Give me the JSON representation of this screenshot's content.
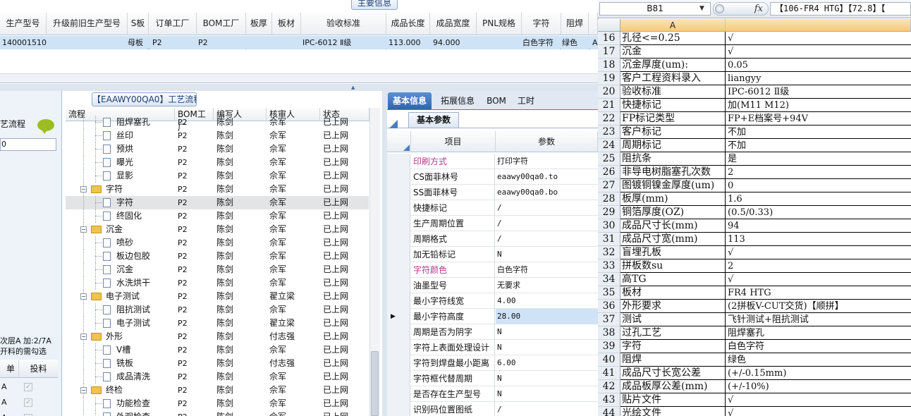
{
  "main_info": {
    "title": "主要信息",
    "columns": [
      "生产型号",
      "升级前旧生产型号",
      "S板",
      "订单工厂",
      "BOM工厂",
      "板厚",
      "板材",
      "验收标准",
      "成品长度",
      "成品宽度",
      "PNL规格",
      "字符",
      "阻焊",
      ""
    ],
    "row": [
      "1400015109",
      "",
      "母板",
      "P2",
      "P2",
      "",
      "",
      "IPC-6012 Ⅱ级",
      "113.000",
      "94.000",
      "",
      "白色字符",
      "绿色",
      "A"
    ]
  },
  "left_panel": {
    "title": "艺流程",
    "field_value": "0",
    "note_line1": "次层A 加:2/7A",
    "note_line2": "开料的需勾选",
    "col_order": "单",
    "col_feed": "投料",
    "rows": [
      "A",
      "A",
      "A"
    ]
  },
  "tree": {
    "title": "【EAAWY00QA0】工艺流程",
    "columns": [
      "流程",
      "BOM工厂",
      "编写人",
      "核审人",
      "状态"
    ],
    "rows": [
      {
        "name": "阻焊塞孔",
        "level": 2,
        "type": "doc",
        "bom": "P2",
        "writer": "陈剑",
        "reviewer": "佘军",
        "status": "已上网"
      },
      {
        "name": "丝印",
        "level": 2,
        "type": "doc",
        "bom": "P2",
        "writer": "陈剑",
        "reviewer": "佘军",
        "status": "已上网"
      },
      {
        "name": "预烘",
        "level": 2,
        "type": "doc",
        "bom": "P2",
        "writer": "陈剑",
        "reviewer": "佘军",
        "status": "已上网"
      },
      {
        "name": "曝光",
        "level": 2,
        "type": "doc",
        "bom": "P2",
        "writer": "陈剑",
        "reviewer": "佘军",
        "status": "已上网"
      },
      {
        "name": "显影",
        "level": 2,
        "type": "doc",
        "bom": "P2",
        "writer": "陈剑",
        "reviewer": "佘军",
        "status": "已上网"
      },
      {
        "name": "字符",
        "level": 1,
        "type": "folder",
        "bom": "P2",
        "writer": "陈剑",
        "reviewer": "佘军",
        "status": "已上网"
      },
      {
        "name": "字符",
        "level": 2,
        "type": "doc",
        "bom": "P2",
        "writer": "陈剑",
        "reviewer": "佘军",
        "status": "已上网"
      },
      {
        "name": "终固化",
        "level": 2,
        "type": "doc",
        "bom": "P2",
        "writer": "陈剑",
        "reviewer": "佘军",
        "status": "已上网"
      },
      {
        "name": "沉金",
        "level": 1,
        "type": "folder",
        "bom": "P2",
        "writer": "陈剑",
        "reviewer": "佘军",
        "status": "已上网"
      },
      {
        "name": "喷砂",
        "level": 2,
        "type": "doc",
        "bom": "P2",
        "writer": "陈剑",
        "reviewer": "佘军",
        "status": "已上网"
      },
      {
        "name": "板边包胶",
        "level": 2,
        "type": "doc",
        "bom": "P2",
        "writer": "陈剑",
        "reviewer": "佘军",
        "status": "已上网"
      },
      {
        "name": "沉金",
        "level": 2,
        "type": "doc",
        "bom": "P2",
        "writer": "陈剑",
        "reviewer": "佘军",
        "status": "已上网"
      },
      {
        "name": "水洗烘干",
        "level": 2,
        "type": "doc",
        "bom": "P2",
        "writer": "陈剑",
        "reviewer": "佘军",
        "status": "已上网"
      },
      {
        "name": "电子测试",
        "level": 1,
        "type": "folder",
        "bom": "P2",
        "writer": "陈剑",
        "reviewer": "翟立梁",
        "status": "已上网"
      },
      {
        "name": "阻抗测试",
        "level": 2,
        "type": "doc",
        "bom": "P2",
        "writer": "陈剑",
        "reviewer": "佘军",
        "status": "已上网"
      },
      {
        "name": "电子测试",
        "level": 2,
        "type": "doc",
        "bom": "P2",
        "writer": "陈剑",
        "reviewer": "翟立梁",
        "status": "已上网"
      },
      {
        "name": "外形",
        "level": 1,
        "type": "folder",
        "bom": "P2",
        "writer": "陈剑",
        "reviewer": "付志强",
        "status": "已上网"
      },
      {
        "name": "V槽",
        "level": 2,
        "type": "doc",
        "bom": "P2",
        "writer": "陈剑",
        "reviewer": "佘军",
        "status": "已上网"
      },
      {
        "name": "铣板",
        "level": 2,
        "type": "doc",
        "bom": "P2",
        "writer": "陈剑",
        "reviewer": "付志强",
        "status": "已上网"
      },
      {
        "name": "成品清洗",
        "level": 2,
        "type": "doc",
        "bom": "P2",
        "writer": "陈剑",
        "reviewer": "佘军",
        "status": "已上网"
      },
      {
        "name": "终检",
        "level": 1,
        "type": "folder",
        "bom": "P2",
        "writer": "陈剑",
        "reviewer": "佘军",
        "status": "已上网"
      },
      {
        "name": "功能检查",
        "level": 2,
        "type": "doc",
        "bom": "P2",
        "writer": "陈剑",
        "reviewer": "佘军",
        "status": "已上网"
      },
      {
        "name": "外观检查",
        "level": 2,
        "type": "doc",
        "bom": "P2",
        "writer": "陈剑",
        "reviewer": "佘军",
        "status": "已上网"
      }
    ]
  },
  "info_panel": {
    "tabs": [
      "基本信息",
      "拓展信息",
      "BOM",
      "工时"
    ],
    "sub_tab": "基本参数",
    "col_item": "项目",
    "col_param": "参数",
    "rows": [
      {
        "item": "印刷方式",
        "value": "打印字符",
        "pink": true
      },
      {
        "item": "CS面菲林号",
        "value": "eaawy00qa0.to",
        "pink": false
      },
      {
        "item": "SS面菲林号",
        "value": "eaawy00qa0.bo",
        "pink": false
      },
      {
        "item": "快捷标记",
        "value": "/",
        "pink": false
      },
      {
        "item": "生产周期位置",
        "value": "/",
        "pink": false
      },
      {
        "item": "周期格式",
        "value": "/",
        "pink": false
      },
      {
        "item": "加无铅标记",
        "value": "N",
        "pink": false
      },
      {
        "item": "字符颜色",
        "value": "白色字符",
        "pink": true
      },
      {
        "item": "油墨型号",
        "value": "无要求",
        "pink": false
      },
      {
        "item": "最小字符线宽",
        "value": "4.00",
        "pink": false
      },
      {
        "item": "最小字符高度",
        "value": "28.00",
        "pink": false
      },
      {
        "item": "周期是否为阴字",
        "value": "N",
        "pink": false
      },
      {
        "item": "字符上表面处理设计",
        "value": "N",
        "pink": false
      },
      {
        "item": "字符到焊盘最小距离",
        "value": "6.00",
        "pink": false
      },
      {
        "item": "字符框代替周期",
        "value": "N",
        "pink": false
      },
      {
        "item": "是否存在生产型号",
        "value": "N",
        "pink": false
      },
      {
        "item": "识别码位置图纸",
        "value": "/",
        "pink": false
      }
    ],
    "selected_index": 10
  },
  "excel": {
    "name_box": "B81",
    "fx_label": "fx",
    "formula": "【106-FR4 HTG】【72.8】【",
    "col_a": "A",
    "rows": [
      {
        "n": "16",
        "a": "孔径<=0.25",
        "b": "√"
      },
      {
        "n": "17",
        "a": "沉金",
        "b": "√"
      },
      {
        "n": "18",
        "a": "沉金厚度(um):",
        "b": "0.05"
      },
      {
        "n": "19",
        "a": "客户工程资料录入",
        "b": "liangyy"
      },
      {
        "n": "20",
        "a": "验收标准",
        "b": "IPC-6012 Ⅱ级"
      },
      {
        "n": "21",
        "a": "快捷标记",
        "b": "加(M11 M12)"
      },
      {
        "n": "22",
        "a": "FP标记类型",
        "b": "FP+E档案号+94V"
      },
      {
        "n": "23",
        "a": "客户标记",
        "b": "不加"
      },
      {
        "n": "24",
        "a": "周期标记",
        "b": "不加"
      },
      {
        "n": "25",
        "a": "阻抗条",
        "b": "是"
      },
      {
        "n": "26",
        "a": "非导电树脂塞孔次数",
        "b": "2"
      },
      {
        "n": "27",
        "a": "图镀铜镍金厚度(um)",
        "b": "0"
      },
      {
        "n": "28",
        "a": "板厚(mm)",
        "b": "1.6"
      },
      {
        "n": "29",
        "a": "铜箔厚度(OZ)",
        "b": "(0.5/0.33)"
      },
      {
        "n": "30",
        "a": "成品尺寸长(mm)",
        "b": "94"
      },
      {
        "n": "31",
        "a": "成品尺寸宽(mm)",
        "b": "113"
      },
      {
        "n": "32",
        "a": "盲埋孔板",
        "b": "√"
      },
      {
        "n": "33",
        "a": "拼板数su",
        "b": "2"
      },
      {
        "n": "34",
        "a": "高TG",
        "b": "√"
      },
      {
        "n": "35",
        "a": "板材",
        "b": "FR4 HTG"
      },
      {
        "n": "36",
        "a": "外形要求",
        "b": "(2拼板V-CUT交货)【顺拼】"
      },
      {
        "n": "37",
        "a": "测试",
        "b": "飞针测试+阻抗测试"
      },
      {
        "n": "38",
        "a": "过孔工艺",
        "b": "阻焊塞孔"
      },
      {
        "n": "39",
        "a": "字符",
        "b": "白色字符"
      },
      {
        "n": "40",
        "a": "阻焊",
        "b": "绿色"
      },
      {
        "n": "41",
        "a": "成品尺寸长宽公差",
        "b": "(+/-0.15mm)"
      },
      {
        "n": "42",
        "a": "成品板厚公差(mm)",
        "b": "(+/-10%)"
      },
      {
        "n": "43",
        "a": "贴片文件",
        "b": "√"
      },
      {
        "n": "44",
        "a": "光绘文件",
        "b": "√"
      }
    ]
  }
}
